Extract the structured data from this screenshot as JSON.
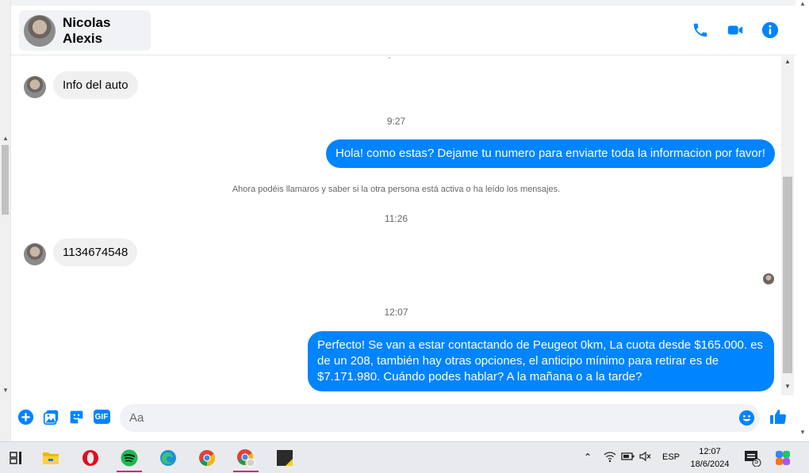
{
  "header": {
    "contact_name": "Nicolas Alexis",
    "icons": [
      "phone-icon",
      "video-camera-icon",
      "info-icon"
    ],
    "accent": "#0084ff"
  },
  "messages": {
    "in_1": "Info del auto",
    "time_1": "9:27",
    "out_1": "Hola! como estas? Dejame tu numero para enviarte toda la informacion por favor!",
    "system_1": "Ahora podéis llamaros y saber si la otra persona está activa o ha leído los mensajes.",
    "time_2": "11:26",
    "in_2": "1134674548",
    "time_3": "12:07",
    "out_2": "Perfecto!  Se van a estar contactando de Peugeot 0km, La cuota desde $165.000. es de un 208, también hay otras opciones, el anticipo mínimo para retirar es de $7.171.980. Cuándo podes hablar? A la mañana o a la tarde?"
  },
  "composer": {
    "placeholder": "Aa",
    "gif_label": "GIF",
    "icons": [
      "plus-circle-icon",
      "photo-icon",
      "sticker-icon",
      "gif-icon",
      "emoji-icon",
      "thumbs-up-icon"
    ]
  },
  "taskbar": {
    "apps": [
      "task-view-icon",
      "file-explorer-icon",
      "opera-icon",
      "spotify-icon",
      "edge-icon",
      "chrome-icon",
      "chrome-profile-icon",
      "sticky-notes-icon"
    ],
    "language": "ESP",
    "time": "12:07",
    "date": "18/6/2024",
    "notification_count": "5"
  }
}
